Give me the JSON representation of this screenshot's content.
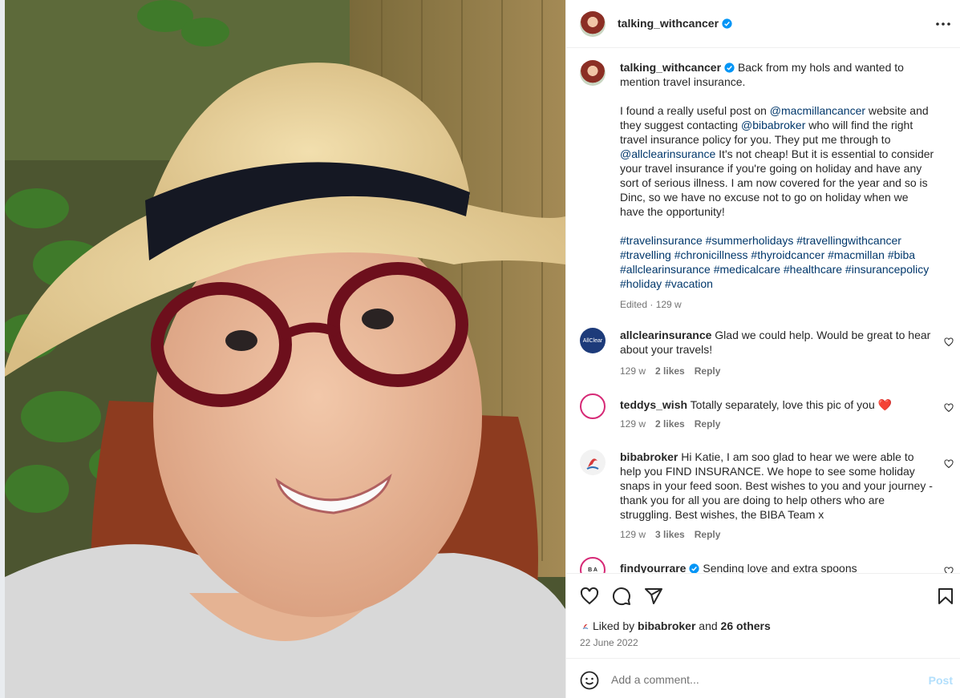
{
  "post": {
    "username": "talking_withcancer",
    "caption_intro": "Back from my hols and wanted to mention travel insurance.",
    "caption_p2_a": "I found a really useful post on ",
    "mention_1": "@macmillancancer",
    "caption_p2_b": " website and they suggest contacting ",
    "mention_2": "@bibabroker",
    "caption_p2_c": " who will find the right travel insurance policy for you. They put me through to ",
    "mention_3": "@allclearinsurance",
    "caption_p2_d": " It's not cheap! But it is essential to consider your travel insurance if you're going on holiday and have any sort of serious illness. I am now covered for the year and so is Dinc, so we have no excuse not to go on holiday when we have the opportunity!",
    "hashtags": "#travelinsurance #summerholidays #travellingwithcancer #travelling #chronicillness #thyroidcancer #macmillan #biba #allclearinsurance #medicalcare #healthcare #insurancepolicy #holiday #vacation",
    "edited": "Edited · 129 w"
  },
  "comments": [
    {
      "username": "allclearinsurance",
      "text": "Glad we could help. Would be great to hear about your travels!",
      "time": "129 w",
      "likes": "2 likes",
      "reply": "Reply",
      "avatar_text": "AllClear"
    },
    {
      "username": "teddys_wish",
      "text": "Totally separately, love this pic of you",
      "emoji": "❤️",
      "time": "129 w",
      "likes": "2 likes",
      "reply": "Reply"
    },
    {
      "username": "bibabroker",
      "text": "Hi Katie, I am soo glad to hear we were able to help you FIND INSURANCE. We hope to see some holiday snaps in your feed soon. Best wishes to you and your journey - thank you for all you are doing to help others who are struggling. Best wishes, the BIBA Team x",
      "time": "129 w",
      "likes": "3 likes",
      "reply": "Reply"
    },
    {
      "username": "findyourrare",
      "text": "Sending love and extra spoons",
      "avatar_text": "B A"
    }
  ],
  "likes": {
    "prefix": "Liked by ",
    "user": "bibabroker",
    "and": " and ",
    "others": "26 others"
  },
  "date": "22 June 2022",
  "composer": {
    "placeholder": "Add a comment...",
    "post_label": "Post"
  },
  "icons": [
    "heart-icon",
    "comment-icon",
    "share-icon",
    "bookmark-icon",
    "more-icon",
    "emoji-icon",
    "verified-icon"
  ],
  "colors": {
    "link": "#00376b",
    "verified": "#0095f6",
    "post_disabled": "#b2dffc",
    "meta": "#737373"
  }
}
